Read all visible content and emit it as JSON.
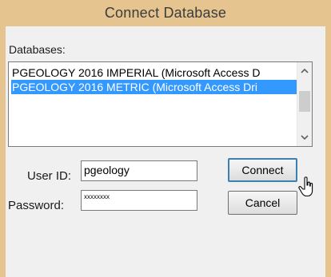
{
  "window": {
    "title": "Connect Database"
  },
  "databases": {
    "label": "Databases:",
    "items": [
      {
        "label": "PGEOLOGY 2016 IMPERIAL (Microsoft Access D",
        "selected": false
      },
      {
        "label": "PGEOLOGY 2016 METRIC (Microsoft Access Dri",
        "selected": true
      }
    ]
  },
  "user_id": {
    "label": "User ID:",
    "value": "pgeology"
  },
  "password": {
    "label": "Password:",
    "masked_value": "xxxxxxxx"
  },
  "buttons": {
    "connect": "Connect",
    "cancel": "Cancel"
  },
  "colors": {
    "frame": "#e5c490",
    "selection": "#3399ff",
    "client_bg": "#f0f0f0"
  },
  "icons": {
    "scroll_up": "chevron-up-icon",
    "scroll_down": "chevron-down-icon",
    "cursor": "mouse-pointer-icon"
  }
}
